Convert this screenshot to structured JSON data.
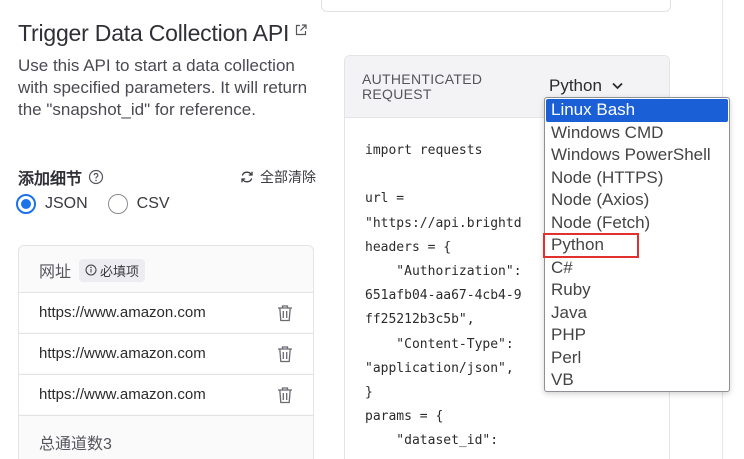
{
  "page": {
    "title": "Trigger Data Collection API",
    "description": "Use this API to start a data collection with specified parameters. It will return the \"snapshot_id\" for reference."
  },
  "details": {
    "label": "添加细节",
    "clear_all": "全部清除",
    "format_options": [
      {
        "label": "JSON",
        "checked": true
      },
      {
        "label": "CSV",
        "checked": false
      }
    ]
  },
  "url_panel": {
    "header": "网址",
    "required_badge": "必填项",
    "rows": [
      {
        "value": "https://www.amazon.com"
      },
      {
        "value": "https://www.amazon.com"
      },
      {
        "value": "https://www.amazon.com"
      }
    ],
    "count_label": "总通道数3"
  },
  "code_panel": {
    "auth_label_line1": "AUTHENTICATED",
    "auth_label_line2": "REQUEST",
    "selected_language": "Python",
    "code_lines": [
      "import requests",
      "",
      "url =",
      "\"https://api.brightd",
      "headers = {",
      "    \"Authorization\":",
      "651afb04-aa67-4cb4-9",
      "ff25212b3c5b\",",
      "    \"Content-Type\":",
      "\"application/json\",",
      "}",
      "params = {",
      "    \"dataset_id\":"
    ]
  },
  "language_dropdown": {
    "items": [
      {
        "label": "Linux Bash",
        "selected": true
      },
      {
        "label": "Windows CMD",
        "selected": false
      },
      {
        "label": "Windows PowerShell",
        "selected": false
      },
      {
        "label": "Node (HTTPS)",
        "selected": false
      },
      {
        "label": "Node (Axios)",
        "selected": false
      },
      {
        "label": "Node (Fetch)",
        "selected": false
      },
      {
        "label": "Python",
        "selected": false
      },
      {
        "label": "C#",
        "selected": false
      },
      {
        "label": "Ruby",
        "selected": false
      },
      {
        "label": "Java",
        "selected": false
      },
      {
        "label": "PHP",
        "selected": false
      },
      {
        "label": "Perl",
        "selected": false
      },
      {
        "label": "VB",
        "selected": false
      }
    ],
    "highlighted": "Python"
  },
  "colors": {
    "accent": "#1a73e8",
    "dropdown_selected": "#1a5fd6",
    "highlight_box": "#e0302f"
  }
}
